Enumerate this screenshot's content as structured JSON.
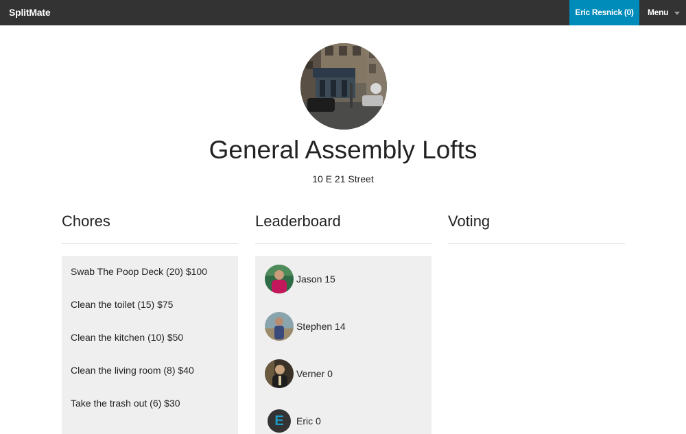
{
  "navbar": {
    "brand": "SplitMate",
    "user_label": "Eric Resnick (0)",
    "menu_label": "Menu"
  },
  "house": {
    "name": "General Assembly Lofts",
    "address": "10 E 21 Street"
  },
  "chores": {
    "title": "Chores",
    "items": [
      {
        "label": "Swab The Poop Deck (20) $100"
      },
      {
        "label": "Clean the toilet (15) $75"
      },
      {
        "label": "Clean the kitchen (10) $50"
      },
      {
        "label": "Clean the living room (8) $40"
      },
      {
        "label": "Take the trash out (6) $30"
      }
    ]
  },
  "leaderboard": {
    "title": "Leaderboard",
    "items": [
      {
        "label": "Jason 15"
      },
      {
        "label": "Stephen 14"
      },
      {
        "label": "Verner 0"
      },
      {
        "label": "Eric 0",
        "initial": "E"
      }
    ]
  },
  "voting": {
    "title": "Voting"
  },
  "colors": {
    "navbar_bg": "#333333",
    "accent": "#008cba",
    "panel_bg": "#efefef"
  }
}
